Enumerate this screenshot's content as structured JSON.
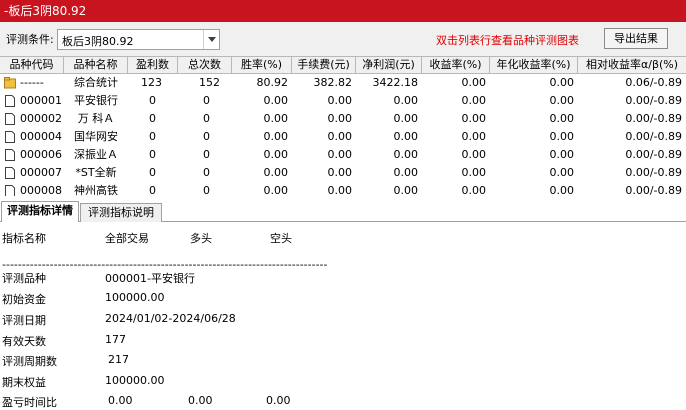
{
  "window": {
    "title": "-板后3阴80.92"
  },
  "toolbar": {
    "condition_label": "评测条件:",
    "condition_value": "板后3阴80.92",
    "hint_text": "双击列表行查看品种评测图表",
    "export_label": "导出结果"
  },
  "table": {
    "columns": [
      "品种代码",
      "品种名称",
      "盈利数",
      "总次数",
      "胜率(%)",
      "手续费(元)",
      "净利润(元)",
      "收益率(%)",
      "年化收益率(%)",
      "相对收益率α/β(%)"
    ],
    "rows": [
      [
        "------",
        "综合统计",
        "123",
        "152",
        "80.92",
        "382.82",
        "3422.18",
        "0.00",
        "0.00",
        "0.06/-0.89"
      ],
      [
        "000001",
        "平安银行",
        "0",
        "0",
        "0.00",
        "0.00",
        "0.00",
        "0.00",
        "0.00",
        "0.00/-0.89"
      ],
      [
        "000002",
        "万 科Ａ",
        "0",
        "0",
        "0.00",
        "0.00",
        "0.00",
        "0.00",
        "0.00",
        "0.00/-0.89"
      ],
      [
        "000004",
        "国华网安",
        "0",
        "0",
        "0.00",
        "0.00",
        "0.00",
        "0.00",
        "0.00",
        "0.00/-0.89"
      ],
      [
        "000006",
        "深振业Ａ",
        "0",
        "0",
        "0.00",
        "0.00",
        "0.00",
        "0.00",
        "0.00",
        "0.00/-0.89"
      ],
      [
        "000007",
        "*ST全新",
        "0",
        "0",
        "0.00",
        "0.00",
        "0.00",
        "0.00",
        "0.00",
        "0.00/-0.89"
      ],
      [
        "000008",
        "神州高铁",
        "0",
        "0",
        "0.00",
        "0.00",
        "0.00",
        "0.00",
        "0.00",
        "0.00/-0.89"
      ]
    ]
  },
  "tabs": [
    "评测指标详情",
    "评测指标说明"
  ],
  "detail": {
    "header": [
      "指标名称",
      "全部交易",
      "多头",
      "空头"
    ],
    "separator": "----------------------------------------------------------------------------------------------------",
    "rows": [
      {
        "label": "评测品种",
        "value": "000001-平安银行"
      },
      {
        "label": "初始资金",
        "value": "100000.00"
      },
      {
        "label": "评测日期",
        "value": "2024/01/02-2024/06/28"
      },
      {
        "label": "有效天数",
        "value": "177"
      },
      {
        "label": "评测周期数",
        "value": "217"
      },
      {
        "label": "期末权益",
        "value": "100000.00"
      },
      {
        "label": "盈亏时间比",
        "value": "0.00",
        "value_long": "0.00",
        "value_short": "0.00"
      }
    ]
  },
  "colors": {
    "titlebar": "#c8141e",
    "hint": "#e00000",
    "folder_icon": "#f0c040"
  }
}
